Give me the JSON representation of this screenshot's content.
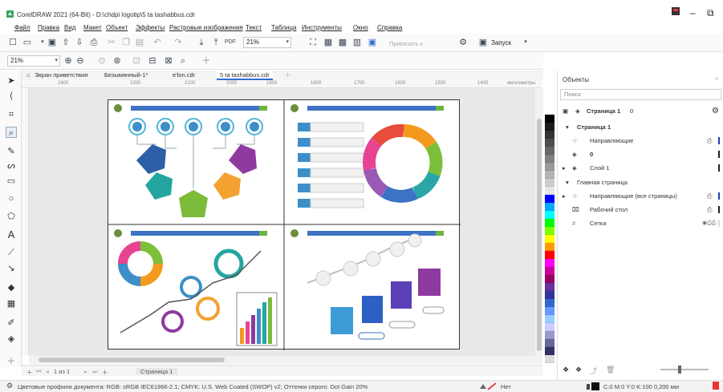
{
  "window": {
    "title": "CorelDRAW 2021 (64-Bit) - D:\\chdpi logotip\\5 ta tashabbus.cdr",
    "min": "–",
    "max": "⧉"
  },
  "menu": [
    "Файл",
    "Правка",
    "Вид",
    "Макет",
    "Объект",
    "Эффекты",
    "Растровые изображения",
    "Текст",
    "Таблица",
    "Инструменты",
    "Окно",
    "Справка"
  ],
  "toolbar": {
    "zoom_value": "21%",
    "snap_label": "Привязать к",
    "launch_label": "Запуск"
  },
  "toolbar2": {
    "zoom_value": "21%"
  },
  "tabs": [
    "Экран приветствия",
    "Безымянный-1*",
    "e'lon.cdr",
    "5 ta tashabbus.cdr"
  ],
  "ruler": {
    "h_ticks": [
      "2400",
      "2200",
      "2100",
      "2000",
      "1900",
      "1800",
      "1700",
      "1600",
      "1500",
      "1400"
    ],
    "units": "миллиметры"
  },
  "pagebar": {
    "page_count": "1 из 1",
    "page_tab": "Страница 1"
  },
  "status": {
    "color_profiles": "Цветовые профили документа: RGB: sRGB IEC61966-2.1; CMYK: U.S. Web Coated (SWOP) v2; Оттенки серого: Dot Gain 20%",
    "fill": "Нет",
    "outline": "C:0 M:0 Y:0 K:100  0,200 мм"
  },
  "panel": {
    "title": "Объекты",
    "search_placeholder": "Поиск",
    "page_header": "Страница 1",
    "page_header_count": "0",
    "rows": [
      {
        "label": "Страница 1"
      },
      {
        "label": "Направляющие"
      },
      {
        "label": "0"
      },
      {
        "label": "Слой 1"
      },
      {
        "label": "Главная страница"
      },
      {
        "label": "Направляющие (все страницы)"
      },
      {
        "label": "Рабочий стол"
      },
      {
        "label": "Сетка"
      }
    ]
  },
  "palette_colors": [
    "#ffffff",
    "#000000",
    "#1a1a1a",
    "#333333",
    "#4d4d4d",
    "#666666",
    "#808080",
    "#999999",
    "#b3b3b3",
    "#cccccc",
    "#e6e6e6",
    "#0000ff",
    "#00aaff",
    "#00ffff",
    "#00ff00",
    "#7fff00",
    "#ffff00",
    "#ff9900",
    "#ff0000",
    "#ff00ff",
    "#cc0099",
    "#990066",
    "#663399",
    "#333399",
    "#3366cc",
    "#6699ff",
    "#99ccff",
    "#ccccff",
    "#9999cc",
    "#666699",
    "#333366",
    "#dddddd"
  ],
  "colors": {
    "accent": "#2f6fd6"
  }
}
